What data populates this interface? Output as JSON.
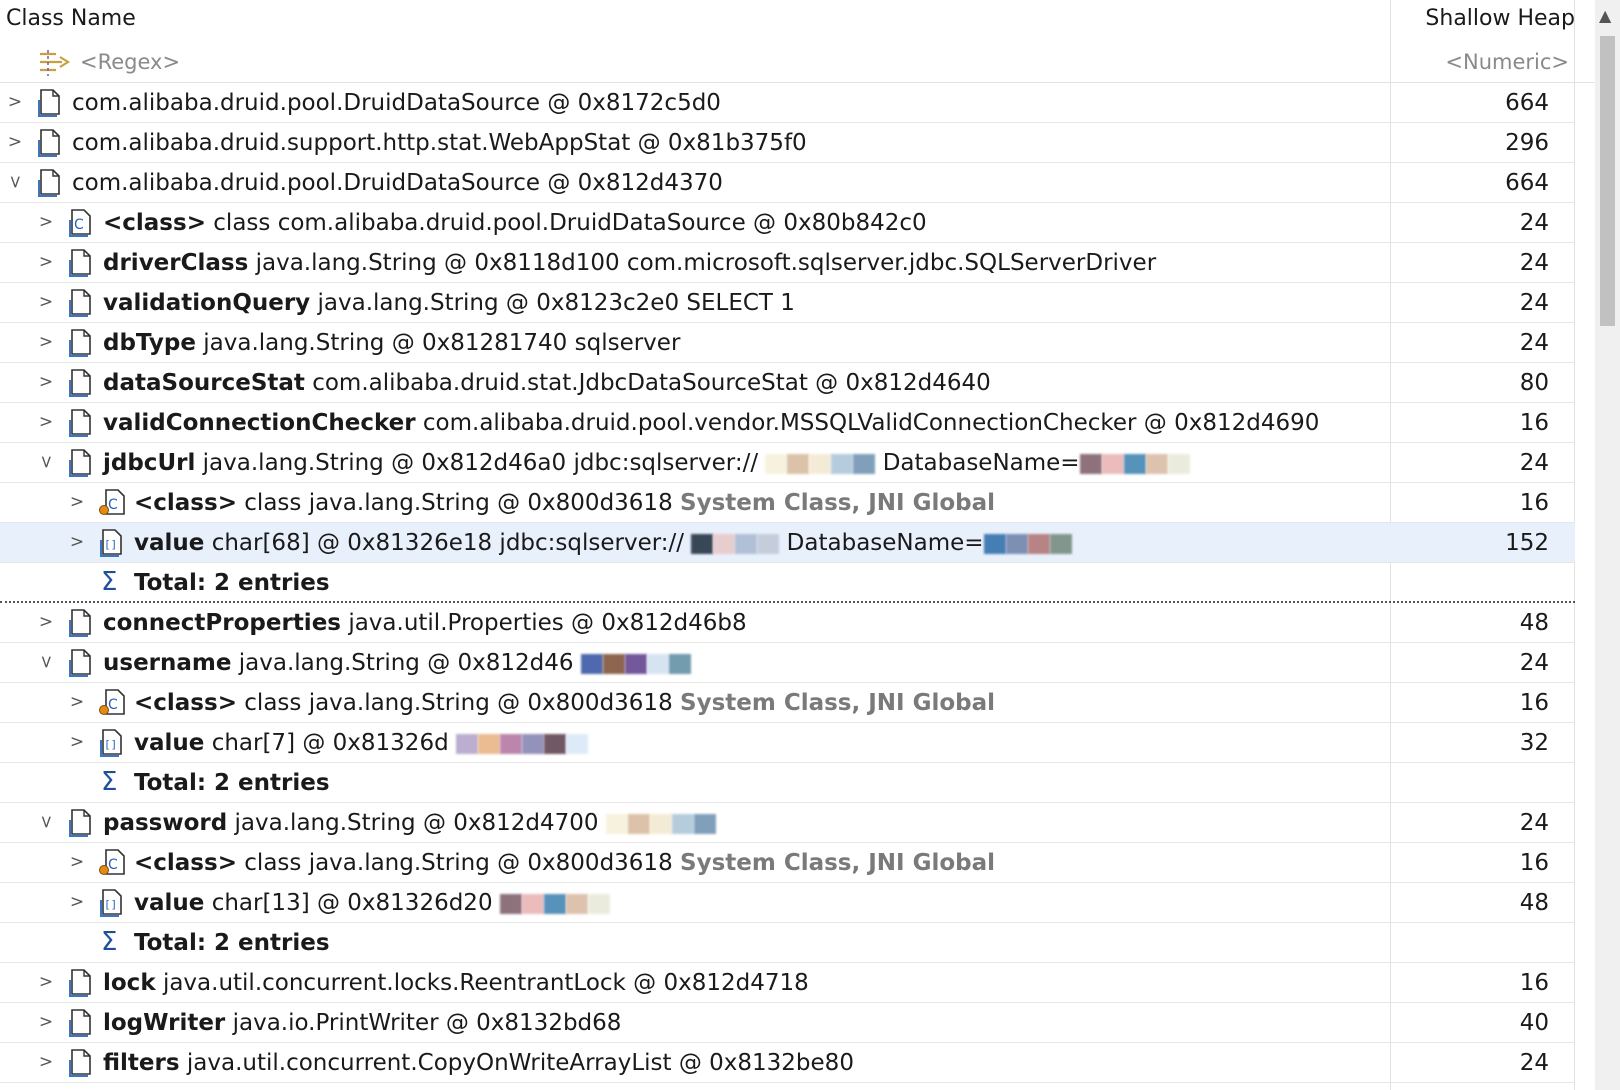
{
  "header": {
    "col_class_name": "Class Name",
    "col_shallow_heap": "Shallow Heap"
  },
  "filter": {
    "regex_placeholder": "<Regex>",
    "numeric_placeholder": "<Numeric>"
  },
  "rows": [
    {
      "level": 0,
      "twisty": "collapsed",
      "icon": "object-icon",
      "field": "",
      "type": "com.alibaba.druid.pool.DruidDataSource @ 0x8172c5d0",
      "extra": "",
      "heap": "664"
    },
    {
      "level": 0,
      "twisty": "collapsed",
      "icon": "object-icon",
      "field": "",
      "type": "com.alibaba.druid.support.http.stat.WebAppStat @ 0x81b375f0",
      "extra": "",
      "heap": "296"
    },
    {
      "level": 0,
      "twisty": "expanded",
      "icon": "object-icon",
      "field": "",
      "type": "com.alibaba.druid.pool.DruidDataSource @ 0x812d4370",
      "extra": "",
      "heap": "664"
    },
    {
      "level": 1,
      "twisty": "collapsed",
      "icon": "class-icon",
      "field": "<class>",
      "type": "class com.alibaba.druid.pool.DruidDataSource @ 0x80b842c0",
      "extra": "",
      "heap": "24"
    },
    {
      "level": 1,
      "twisty": "collapsed",
      "icon": "object-icon",
      "field": "driverClass",
      "type": "java.lang.String @ 0x8118d100  com.microsoft.sqlserver.jdbc.SQLServerDriver",
      "extra": "",
      "heap": "24"
    },
    {
      "level": 1,
      "twisty": "collapsed",
      "icon": "object-icon",
      "field": "validationQuery",
      "type": "java.lang.String @ 0x8123c2e0  SELECT 1",
      "extra": "",
      "heap": "24"
    },
    {
      "level": 1,
      "twisty": "collapsed",
      "icon": "object-icon",
      "field": "dbType",
      "type": "java.lang.String @ 0x81281740  sqlserver",
      "extra": "",
      "heap": "24"
    },
    {
      "level": 1,
      "twisty": "collapsed",
      "icon": "object-icon",
      "field": "dataSourceStat",
      "type": "com.alibaba.druid.stat.JdbcDataSourceStat @ 0x812d4640",
      "extra": "",
      "heap": "80"
    },
    {
      "level": 1,
      "twisty": "collapsed",
      "icon": "object-icon",
      "field": "validConnectionChecker",
      "type": "com.alibaba.druid.pool.vendor.MSSQLValidConnectionChecker @ 0x812d4690",
      "extra": "",
      "heap": "16"
    },
    {
      "level": 1,
      "twisty": "expanded",
      "icon": "object-icon",
      "field": "jdbcUrl",
      "type": "java.lang.String @ 0x812d46a0  jdbc:sqlserver://",
      "extra": "DatabaseName=",
      "heap": "24"
    },
    {
      "level": 2,
      "twisty": "collapsed",
      "icon": "class-gc-root-icon",
      "field": "<class>",
      "type": "class java.lang.String @ 0x800d3618",
      "extra": "System Class, JNI Global",
      "heap": "16"
    },
    {
      "level": 2,
      "twisty": "collapsed",
      "icon": "array-icon",
      "field": "value",
      "type": "char[68] @ 0x81326e18  jdbc:sqlserver://",
      "extra": "DatabaseName=",
      "heap": "152",
      "selected": true
    },
    {
      "level": 2,
      "twisty": "none",
      "icon": "sigma-icon",
      "field": "Total: 2 entries",
      "type": "",
      "extra": "",
      "heap": ""
    },
    {
      "level": 1,
      "twisty": "collapsed",
      "icon": "object-icon",
      "field": "connectProperties",
      "type": "java.util.Properties @ 0x812d46b8",
      "extra": "",
      "heap": "48"
    },
    {
      "level": 1,
      "twisty": "expanded",
      "icon": "object-icon",
      "field": "username",
      "type": "java.lang.String @ 0x812d46",
      "extra": "",
      "heap": "24"
    },
    {
      "level": 2,
      "twisty": "collapsed",
      "icon": "class-gc-root-icon",
      "field": "<class>",
      "type": "class java.lang.String @ 0x800d3618",
      "extra": "System Class, JNI Global",
      "heap": "16"
    },
    {
      "level": 2,
      "twisty": "collapsed",
      "icon": "array-icon",
      "field": "value",
      "type": "char[7] @ 0x81326d",
      "extra": "",
      "heap": "32"
    },
    {
      "level": 2,
      "twisty": "none",
      "icon": "sigma-icon",
      "field": "Total: 2 entries",
      "type": "",
      "extra": "",
      "heap": ""
    },
    {
      "level": 1,
      "twisty": "expanded",
      "icon": "object-icon",
      "field": "password",
      "type": "java.lang.String @ 0x812d4700",
      "extra": "",
      "heap": "24"
    },
    {
      "level": 2,
      "twisty": "collapsed",
      "icon": "class-gc-root-icon",
      "field": "<class>",
      "type": "class java.lang.String @ 0x800d3618",
      "extra": "System Class, JNI Global",
      "heap": "16"
    },
    {
      "level": 2,
      "twisty": "collapsed",
      "icon": "array-icon",
      "field": "value",
      "type": "char[13] @ 0x81326d20",
      "extra": "",
      "heap": "48"
    },
    {
      "level": 2,
      "twisty": "none",
      "icon": "sigma-icon",
      "field": "Total: 2 entries",
      "type": "",
      "extra": "",
      "heap": ""
    },
    {
      "level": 1,
      "twisty": "collapsed",
      "icon": "object-icon",
      "field": "lock",
      "type": "java.util.concurrent.locks.ReentrantLock @ 0x812d4718",
      "extra": "",
      "heap": "16"
    },
    {
      "level": 1,
      "twisty": "collapsed",
      "icon": "object-icon",
      "field": "logWriter",
      "type": "java.io.PrintWriter @ 0x8132bd68",
      "extra": "",
      "heap": "40"
    },
    {
      "level": 1,
      "twisty": "collapsed",
      "icon": "object-icon",
      "field": "filters",
      "type": "java.util.concurrent.CopyOnWriteArrayList @ 0x8132be80",
      "extra": "",
      "heap": "24"
    }
  ]
}
